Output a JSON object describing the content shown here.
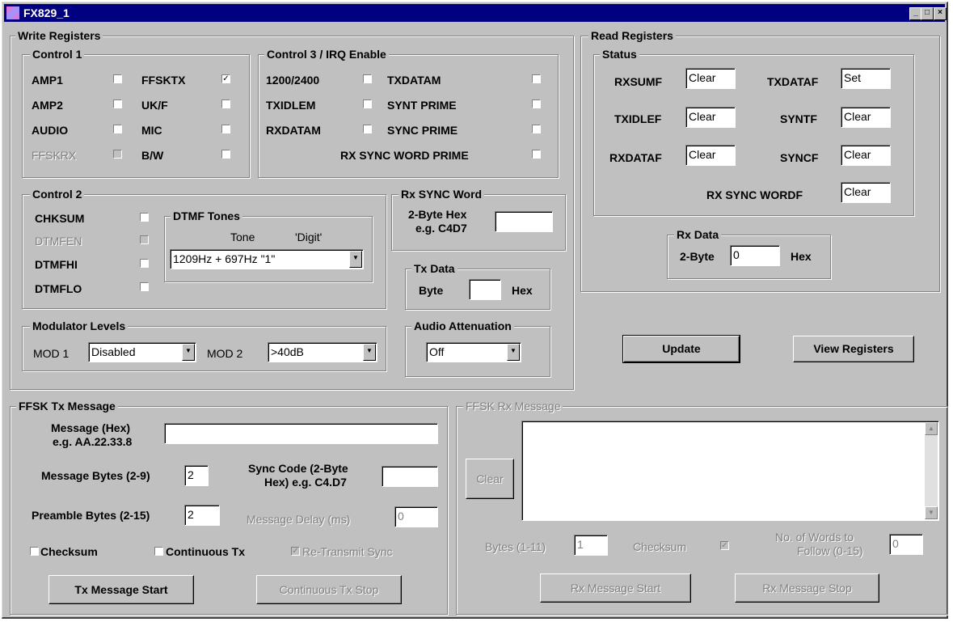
{
  "window": {
    "title": "FX829_1",
    "min": "_",
    "max": "□",
    "close": "×"
  },
  "write": {
    "title": "Write Registers",
    "control1": {
      "title": "Control 1",
      "items": [
        {
          "label": "AMP1",
          "checked": false,
          "enabled": true
        },
        {
          "label": "AMP2",
          "checked": false,
          "enabled": true
        },
        {
          "label": "AUDIO",
          "checked": false,
          "enabled": true
        },
        {
          "label": "FFSKRX",
          "checked": false,
          "enabled": false
        },
        {
          "label": "FFSKTX",
          "checked": true,
          "enabled": true
        },
        {
          "label": "UK/F",
          "checked": false,
          "enabled": true
        },
        {
          "label": "MIC",
          "checked": false,
          "enabled": true
        },
        {
          "label": "B/W",
          "checked": false,
          "enabled": true
        }
      ]
    },
    "control3": {
      "title": "Control 3 / IRQ Enable",
      "items": [
        {
          "label": "1200/2400",
          "checked": false
        },
        {
          "label": "TXIDLEM",
          "checked": false
        },
        {
          "label": "RXDATAM",
          "checked": false
        },
        {
          "label": "TXDATAM",
          "checked": false
        },
        {
          "label": "SYNT PRIME",
          "checked": false
        },
        {
          "label": "SYNC PRIME",
          "checked": false
        },
        {
          "label": "RX SYNC WORD PRIME",
          "checked": false
        }
      ]
    },
    "control2": {
      "title": "Control 2",
      "items": [
        {
          "label": "CHKSUM",
          "checked": false,
          "enabled": true
        },
        {
          "label": "DTMFEN",
          "checked": false,
          "enabled": false
        },
        {
          "label": "DTMFHI",
          "checked": false,
          "enabled": true
        },
        {
          "label": "DTMFLO",
          "checked": false,
          "enabled": true
        }
      ]
    },
    "dtmf": {
      "title": "DTMF Tones",
      "tone_header": "Tone",
      "digit_header": "'Digit'",
      "selected": "1209Hz + 697Hz   \"1\""
    },
    "rxsync": {
      "title": "Rx SYNC Word",
      "label1": "2-Byte Hex",
      "label2": "e.g. C4D7",
      "value": ""
    },
    "txdata": {
      "title": "Tx Data",
      "byte_label": "Byte",
      "hex_label": "Hex",
      "value": ""
    },
    "modulator": {
      "title": "Modulator Levels",
      "mod1_label": "MOD 1",
      "mod1_value": "Disabled",
      "mod2_label": "MOD 2",
      "mod2_value": ">40dB"
    },
    "audio": {
      "title": "Audio Attenuation",
      "value": "Off"
    }
  },
  "read": {
    "title": "Read Registers",
    "status": {
      "title": "Status",
      "items": [
        {
          "label": "RXSUMF",
          "value": "Clear"
        },
        {
          "label": "TXDATAF",
          "value": "Set"
        },
        {
          "label": "TXIDLEF",
          "value": "Clear"
        },
        {
          "label": "SYNTF",
          "value": "Clear"
        },
        {
          "label": "RXDATAF",
          "value": "Clear"
        },
        {
          "label": "SYNCF",
          "value": "Clear"
        },
        {
          "label": "RX SYNC WORDF",
          "value": "Clear"
        }
      ]
    },
    "rxdata": {
      "title": "Rx Data",
      "label": "2-Byte",
      "value": "0",
      "hex_label": "Hex"
    },
    "update_button": "Update",
    "view_button": "View Registers"
  },
  "ffsk_tx": {
    "title": "FFSK Tx Message",
    "message_label1": "Message (Hex)",
    "message_label2": "e.g. AA.22.33.8",
    "message_value": "",
    "msg_bytes_label": "Message Bytes (2-9)",
    "msg_bytes_value": "2",
    "sync_label1": "Sync Code (2-Byte",
    "sync_label2": "Hex) e.g. C4.D7",
    "sync_value": "",
    "preamble_label": "Preamble Bytes (2-15)",
    "preamble_value": "2",
    "delay_label": "Message Delay (ms)",
    "delay_value": "0",
    "checksum_label": "Checksum",
    "continuous_label": "Continuous Tx",
    "retransmit_label": "Re-Transmit Sync",
    "start_button": "Tx Message Start",
    "stop_button": "Continuous Tx Stop"
  },
  "ffsk_rx": {
    "title": "FFSK Rx Message",
    "clear_button": "Clear",
    "bytes_label": "Bytes (1-11)",
    "bytes_value": "1",
    "checksum_label": "Checksum",
    "words_label1": "No. of Words to",
    "words_label2": "Follow (0-15)",
    "words_value": "0",
    "start_button": "Rx Message Start",
    "stop_button": "Rx Message Stop"
  }
}
